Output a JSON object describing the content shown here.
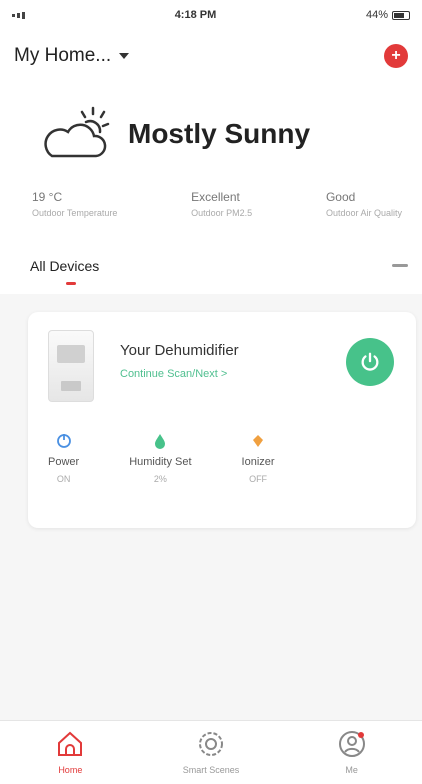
{
  "status_bar": {
    "time": "4:18 PM",
    "battery": "44%"
  },
  "header": {
    "home_name": "My Home..."
  },
  "weather": {
    "condition": "Mostly Sunny",
    "metrics": [
      {
        "value": "19 °C",
        "label": "Outdoor Temperature"
      },
      {
        "value": "Excellent",
        "label": "Outdoor PM2.5"
      },
      {
        "value": "Good",
        "label": "Outdoor Air Quality"
      }
    ]
  },
  "devices": {
    "title": "All Devices"
  },
  "device": {
    "name": "Your Dehumidifier",
    "link": "Continue Scan/Next >",
    "controls": [
      {
        "label": "Power",
        "value": "ON",
        "color": "#4a90e2"
      },
      {
        "label": "Humidity Set",
        "value": "2%",
        "color": "#47c28a"
      },
      {
        "label": "Ionizer",
        "value": "OFF",
        "color": "#f0a040"
      }
    ]
  },
  "tabs": [
    {
      "label": "Home",
      "icon": "home-icon",
      "active": true
    },
    {
      "label": "Smart Scenes",
      "icon": "gear-icon",
      "active": false
    },
    {
      "label": "Me",
      "icon": "profile-icon",
      "active": false
    }
  ],
  "colors": {
    "accent": "#e23a3a",
    "power": "#47c28a"
  }
}
